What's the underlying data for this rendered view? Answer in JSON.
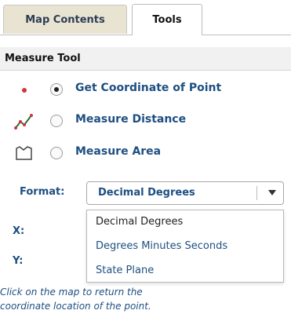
{
  "tabs": [
    {
      "label": "Map Contents",
      "active": false
    },
    {
      "label": "Tools",
      "active": true
    }
  ],
  "section_title": "Measure Tool",
  "options": [
    {
      "label": "Get Coordinate of Point",
      "icon": "point-icon",
      "selected": true
    },
    {
      "label": "Measure Distance",
      "icon": "polyline-icon",
      "selected": false
    },
    {
      "label": "Measure Area",
      "icon": "polygon-icon",
      "selected": false
    }
  ],
  "format": {
    "label": "Format:",
    "selected": "Decimal Degrees",
    "options": [
      "Decimal Degrees",
      "Degrees Minutes Seconds",
      "State Plane"
    ]
  },
  "coords": {
    "x_label": "X:",
    "y_label": "Y:"
  },
  "hint": {
    "line1": "Click on the map to return the",
    "line2": "coordinate location of the point."
  },
  "colors": {
    "accent": "#1e4f82",
    "tab_inactive": "#e9e3d2",
    "point_red": "#d2343a"
  }
}
